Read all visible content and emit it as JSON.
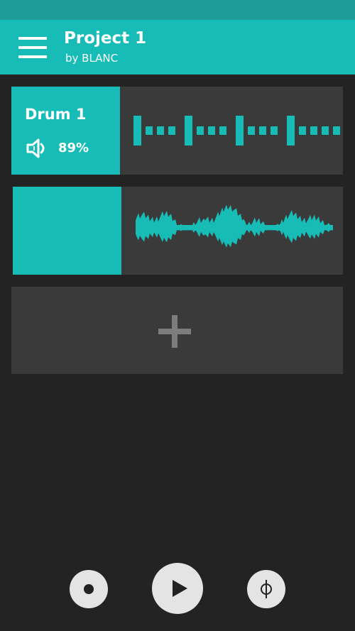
{
  "header": {
    "title": "Project 1",
    "subtitle": "by BLANC",
    "menu_icon": "hamburger-menu-icon"
  },
  "colors": {
    "accent": "#17bcb7",
    "status_bar": "#1c9c97",
    "background": "#232323",
    "track_bg": "#3a3a3a",
    "control_bg": "#e4e4e4"
  },
  "tracks": [
    {
      "name": "Drum 1",
      "volume": "89%",
      "volume_icon": "speaker-icon",
      "lane": "drum-pattern"
    },
    {
      "name": "",
      "lane": "audio-waveform"
    }
  ],
  "add_track": {
    "icon": "plus-icon"
  },
  "transport": {
    "record_icon": "record-icon",
    "play_icon": "play-icon",
    "metronome_icon": "metronome-icon"
  }
}
